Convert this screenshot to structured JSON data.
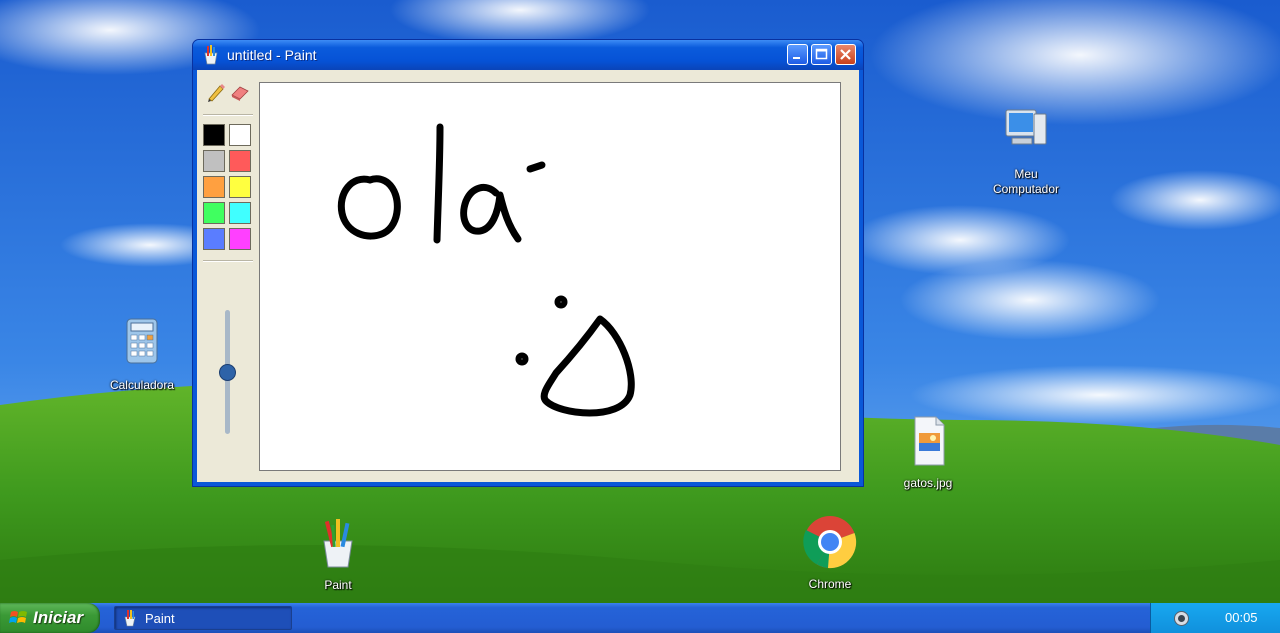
{
  "window": {
    "title": "untitled - Paint",
    "colors": [
      "#000000",
      "#ffffff",
      "#c0c0c0",
      "#ff5a5a",
      "#ffa040",
      "#ffff40",
      "#40ff60",
      "#40ffff",
      "#5a7dff",
      "#ff40ff"
    ],
    "brush_size_level": 0.5,
    "canvas_drawing": "ola · :D (handwritten)"
  },
  "desktop_icons": {
    "my_computer": "Meu\nComputador",
    "calculator": "Calculadora",
    "image_file": "gatos.jpg",
    "paint": "Paint",
    "chrome": "Chrome"
  },
  "taskbar": {
    "start_label": "Iniciar",
    "task_paint": "Paint",
    "clock": "00:05"
  },
  "theme": {
    "sky": "#2a6fd8",
    "grass": "#3f9a1e",
    "window_blue": "#0a58d8",
    "taskbar_blue": "#245dd2",
    "start_green": "#3b9a36"
  }
}
